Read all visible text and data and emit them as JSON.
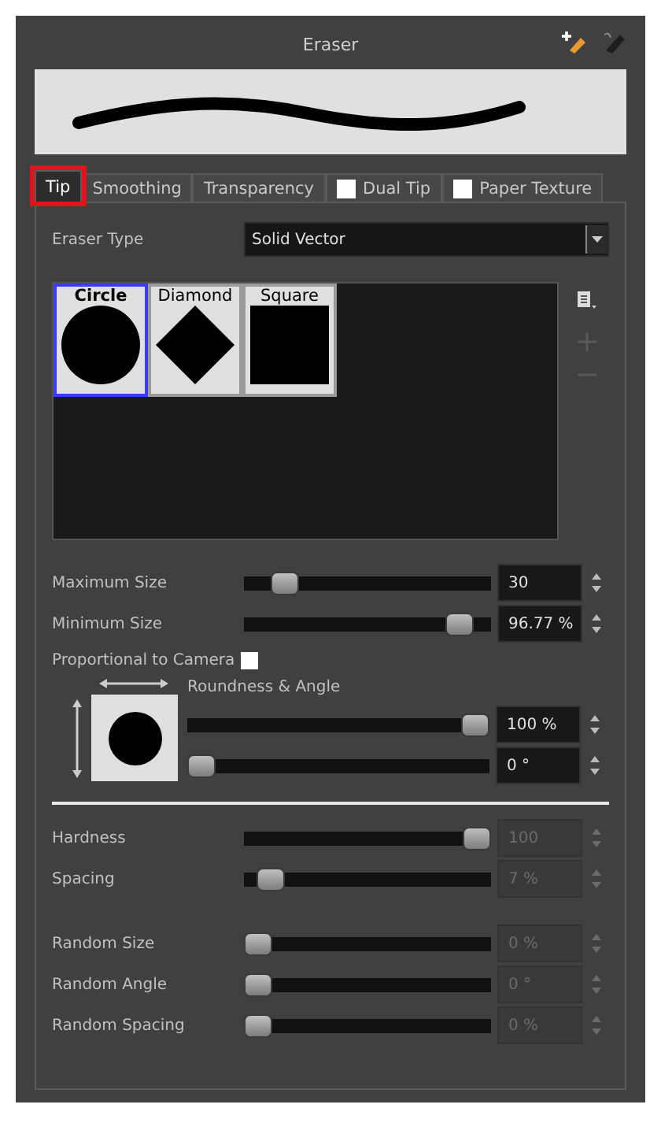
{
  "panel": {
    "title": "Eraser"
  },
  "tabs": [
    {
      "label": "Tip",
      "kind": "plain",
      "selected": true,
      "highlighted": true
    },
    {
      "label": "Smoothing",
      "kind": "plain",
      "selected": false,
      "highlighted": false
    },
    {
      "label": "Transparency",
      "kind": "plain",
      "selected": false,
      "highlighted": false
    },
    {
      "label": "Dual Tip",
      "kind": "checkbox",
      "checked": false,
      "selected": false,
      "highlighted": false
    },
    {
      "label": "Paper Texture",
      "kind": "checkbox",
      "checked": false,
      "selected": false,
      "highlighted": false
    }
  ],
  "eraser_type": {
    "label": "Eraser Type",
    "value": "Solid Vector"
  },
  "tips": [
    {
      "name": "Circle",
      "kind": "circle",
      "selected": true
    },
    {
      "name": "Diamond",
      "kind": "diamond",
      "selected": false
    },
    {
      "name": "Square",
      "kind": "square",
      "selected": false
    }
  ],
  "size_sliders": [
    {
      "label": "Maximum Size",
      "level": 0.12,
      "value": "30",
      "disabled": false
    },
    {
      "label": "Minimum Size",
      "level": 0.92,
      "value": "96.77 %",
      "disabled": false
    }
  ],
  "proportional": {
    "label": "Proportional to Camera",
    "checked": false
  },
  "roundness": {
    "label": "Roundness & Angle",
    "sliders": [
      {
        "level": 1,
        "value": "100 %",
        "disabled": false
      },
      {
        "level": 0,
        "value": "0 °",
        "disabled": false
      }
    ]
  },
  "hardness_sliders": [
    {
      "label": "Hardness",
      "level": 1,
      "value": "100",
      "disabled": true
    },
    {
      "label": "Spacing",
      "level": 0.06,
      "value": "7 %",
      "disabled": true
    }
  ],
  "random_sliders": [
    {
      "label": "Random Size",
      "level": 0,
      "value": "0 %",
      "disabled": true
    },
    {
      "label": "Random Angle",
      "level": 0,
      "value": "0 °",
      "disabled": true
    },
    {
      "label": "Random Spacing",
      "level": 0,
      "value": "0 %",
      "disabled": true
    }
  ]
}
